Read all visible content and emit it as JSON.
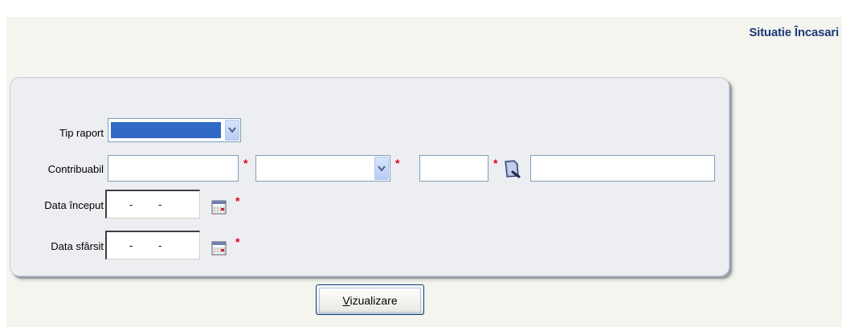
{
  "header": {
    "title": "Situatie Încasari"
  },
  "form": {
    "tip_raport": {
      "label": "Tip raport",
      "selected_value": ""
    },
    "contribuabil": {
      "label": "Contribuabil",
      "field1_value": "",
      "select_value": "",
      "field3_value": "",
      "field4_value": ""
    },
    "data_inceput": {
      "label": "Data început",
      "value": "- -"
    },
    "data_sfarsit": {
      "label": "Data sfârsit",
      "value": "- -"
    },
    "required_mark": "*"
  },
  "actions": {
    "view_button_accesskey": "V",
    "view_button_rest": "izualizare"
  },
  "icons": {
    "dropdown": "chevron-down-icon",
    "calendar": "calendar-icon",
    "lookup": "folder-lookup-icon"
  },
  "colors": {
    "title": "#1f3a78",
    "required": "#e0001b",
    "selection": "#3169c6",
    "panel": "#eceef2"
  }
}
